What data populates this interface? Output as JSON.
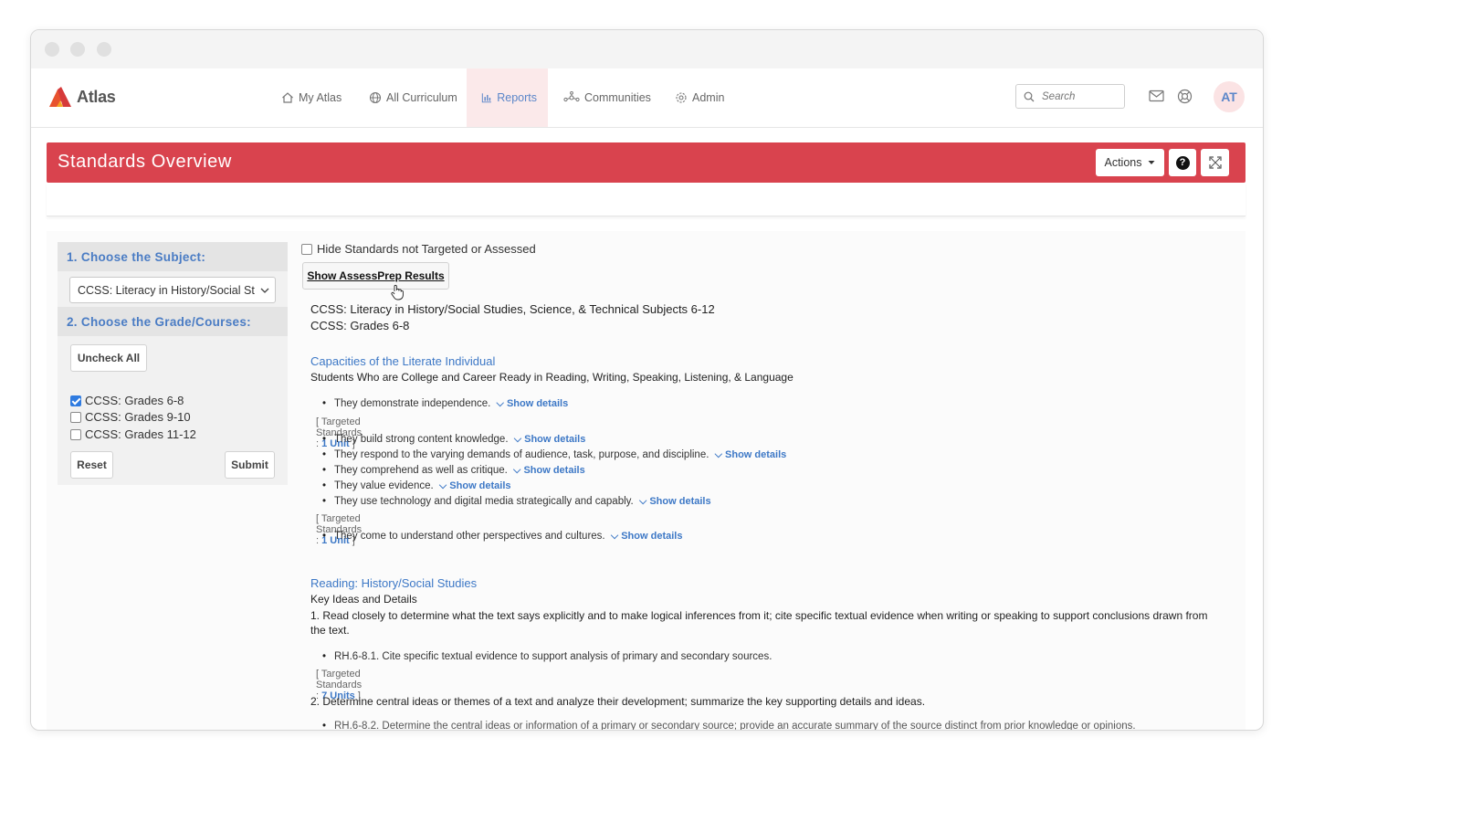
{
  "nav": {
    "logo": "Atlas",
    "items": [
      {
        "label": "My Atlas"
      },
      {
        "label": "All Curriculum"
      },
      {
        "label": "Reports"
      },
      {
        "label": "Communities"
      },
      {
        "label": "Admin"
      }
    ],
    "search_placeholder": "Search",
    "avatar": "AT"
  },
  "header": {
    "title": "Standards Overview",
    "actions_label": "Actions",
    "help_label": "?"
  },
  "sidebar": {
    "subject_heading": "1. Choose the Subject:",
    "subject_value": "CCSS: Literacy in History/Social St",
    "grade_heading": "2. Choose the Grade/Courses:",
    "uncheck_all": "Uncheck All",
    "grades": [
      {
        "label": "CCSS: Grades 6-8",
        "checked": true
      },
      {
        "label": "CCSS: Grades 9-10",
        "checked": false
      },
      {
        "label": "CCSS: Grades 11-12",
        "checked": false
      }
    ],
    "reset": "Reset",
    "submit": "Submit"
  },
  "main": {
    "hide_label": "Hide Standards not Targeted or Assessed",
    "assessprep_button": "Show AssessPrep Results",
    "subject_line": "CCSS: Literacy in History/Social Studies, Science, & Technical Subjects 6-12",
    "grade_line": "CCSS: Grades 6-8",
    "section1": {
      "title": "Capacities of the Literate Individual",
      "subtitle": "Students Who are College and Career Ready in Reading, Writing, Speaking, Listening, & Language",
      "items": [
        {
          "text": "They demonstrate independence.",
          "link": "Show details"
        },
        {
          "text": "They build strong content knowledge.",
          "link": "Show details"
        },
        {
          "text": "They respond to the varying demands of audience, task, purpose, and discipline.",
          "link": "Show details"
        },
        {
          "text": "They comprehend as well as critique.",
          "link": "Show details"
        },
        {
          "text": "They value evidence.",
          "link": "Show details"
        },
        {
          "text": "They use technology and digital media strategically and capably.",
          "link": "Show details"
        },
        {
          "text": "They come to understand other perspectives and cultures.",
          "link": "Show details"
        }
      ],
      "targeted_prefix": "[ Targeted Standards :",
      "targeted_suffix": "]",
      "targeted_1": "1 Unit",
      "targeted_2": "1 Unit"
    },
    "section2": {
      "title": "Reading: History/Social Studies",
      "subtitle": "Key Ideas and Details",
      "std1": "1. Read closely to determine what the text says explicitly and to make logical inferences from it; cite specific textual evidence when writing or speaking to support conclusions drawn from the text.",
      "std1_item": "RH.6-8.1. Cite specific textual evidence to support analysis of primary and secondary sources.",
      "std1_targeted": "7 Units",
      "std2": "2. Determine central ideas or themes of a text and analyze their development; summarize the key supporting details and ideas.",
      "std2_item": "RH.6-8.2. Determine the central ideas or information of a primary or secondary source; provide an accurate summary of the source distinct from prior knowledge or opinions."
    }
  },
  "colors": {
    "header_red": "#d9434e",
    "link_blue": "#3d78c6",
    "active_nav_bg": "#fbe9ea"
  }
}
